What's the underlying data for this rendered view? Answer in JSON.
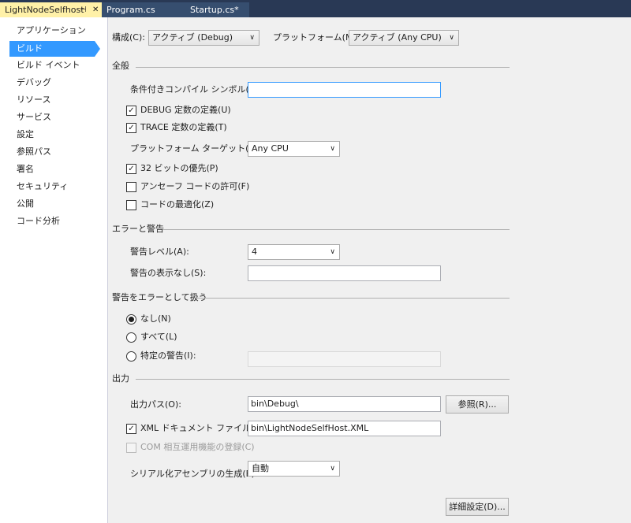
{
  "tabs": [
    {
      "label": "LightNodeSelfhost",
      "pin_glyph": "⊣",
      "close_glyph": "✕"
    },
    {
      "label": "Program.cs"
    },
    {
      "label": "Startup.cs*"
    }
  ],
  "nav": [
    "アプリケーション",
    "ビルド",
    "ビルド イベント",
    "デバッグ",
    "リソース",
    "サービス",
    "設定",
    "参照パス",
    "署名",
    "セキュリティ",
    "公開",
    "コード分析"
  ],
  "top": {
    "config_label": "構成(C):",
    "config_value": "アクティブ (Debug)",
    "platform_label": "プラットフォーム(M):",
    "platform_value": "アクティブ (Any CPU)"
  },
  "general": {
    "title": "全般",
    "symbols_label": "条件付きコンパイル シンボル(Y):",
    "symbols_value": "",
    "debug_label": "DEBUG 定数の定義(U)",
    "debug_checked": true,
    "trace_label": "TRACE 定数の定義(T)",
    "trace_checked": true,
    "target_label": "プラットフォーム ターゲット(G):",
    "target_value": "Any CPU",
    "prefer32_label": "32 ビットの優先(P)",
    "prefer32_checked": true,
    "unsafe_label": "アンセーフ コードの許可(F)",
    "unsafe_checked": false,
    "optimize_label": "コードの最適化(Z)",
    "optimize_checked": false
  },
  "errors": {
    "title": "エラーと警告",
    "level_label": "警告レベル(A):",
    "level_value": "4",
    "suppress_label": "警告の表示なし(S):",
    "suppress_value": ""
  },
  "treat": {
    "title": "警告をエラーとして扱う",
    "none_label": "なし(N)",
    "all_label": "すべて(L)",
    "specific_label": "特定の警告(I):",
    "selected": "none",
    "specific_value": ""
  },
  "output": {
    "title": "出力",
    "path_label": "出力パス(O):",
    "path_value": "bin\\Debug\\",
    "browse_label": "参照(R)...",
    "xml_label": "XML ドキュメント ファイル(X):",
    "xml_checked": true,
    "xml_value": "bin\\LightNodeSelfHost.XML",
    "com_label": "COM 相互運用機能の登録(C)",
    "serial_label": "シリアル化アセンブリの生成(E):",
    "serial_value": "自動",
    "advanced_label": "詳細設定(D)..."
  },
  "icons": {
    "chevron": "∨",
    "check": "✓"
  },
  "colors": {
    "tab_bar": "#293955",
    "active_tab": "#fff1a8",
    "nav_selected": "#3399ff"
  }
}
